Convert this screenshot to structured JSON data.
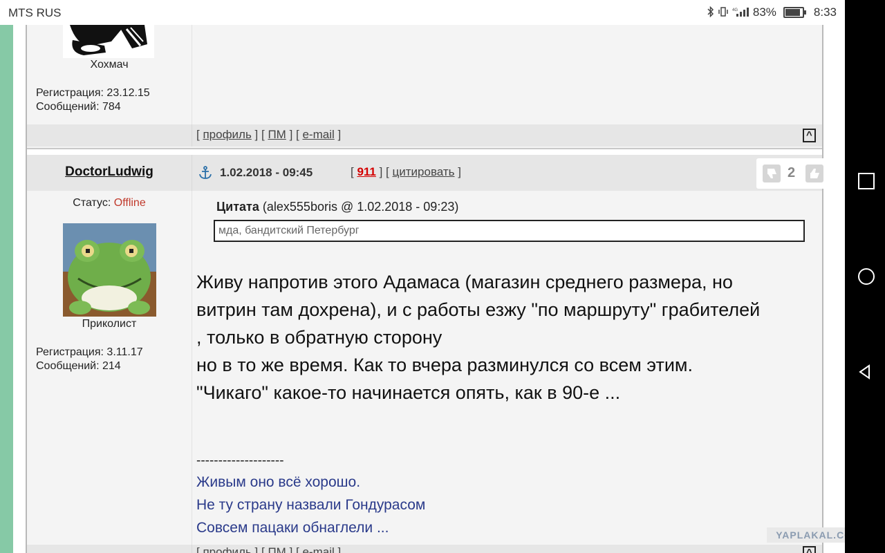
{
  "status_bar": {
    "carrier": "MTS RUS",
    "battery_percent": "83%",
    "time": "8:33"
  },
  "post1": {
    "rank": "Хохмач",
    "registration": "Регистрация: 23.12.15",
    "messages": "Сообщений: 784",
    "links": {
      "profile": "профиль",
      "pm": "ПМ",
      "email": "e-mail"
    },
    "top_label": "^"
  },
  "post2": {
    "username": "DoctorLudwig",
    "date": "1.02.2018 - 09:45",
    "post_number": "911",
    "quote_link": "цитировать",
    "rating": "2",
    "status_label": "Статус:",
    "status_value": "Offline",
    "rank": "Приколист",
    "registration": "Регистрация: 3.11.17",
    "messages": "Сообщений: 214",
    "quote_title": "Цитата",
    "quote_meta": "(alex555boris @ 1.02.2018 - 09:23)",
    "quote_text": "мда, бандитский Петербург",
    "body_lines": [
      "Живу напротив этого Адамаса (магазин среднего размера, но",
      "витрин там дохрена), и с работы езжу \"по маршруту\" грабителей",
      ", только в обратную сторону",
      "но в то же время. Как то вчера разминулся со всем этим.",
      "\"Чикаго\" какое-то начинается опять, как в 90-е ..."
    ],
    "sig_divider": "--------------------",
    "signature": [
      "Живым оно всё хорошо.",
      "Не ту страну назвали Гондурасом",
      "Совсем пацаки обнаглели ..."
    ],
    "links": {
      "profile": "профиль",
      "pm": "ПМ",
      "email": "e-mail"
    }
  },
  "watermark": "YAPLAKAL.COM",
  "colors": {
    "accent_stripe": "#86c9a6",
    "offline": "#c0392b",
    "post_number": "#d40000",
    "signature": "#2a3a8a"
  }
}
